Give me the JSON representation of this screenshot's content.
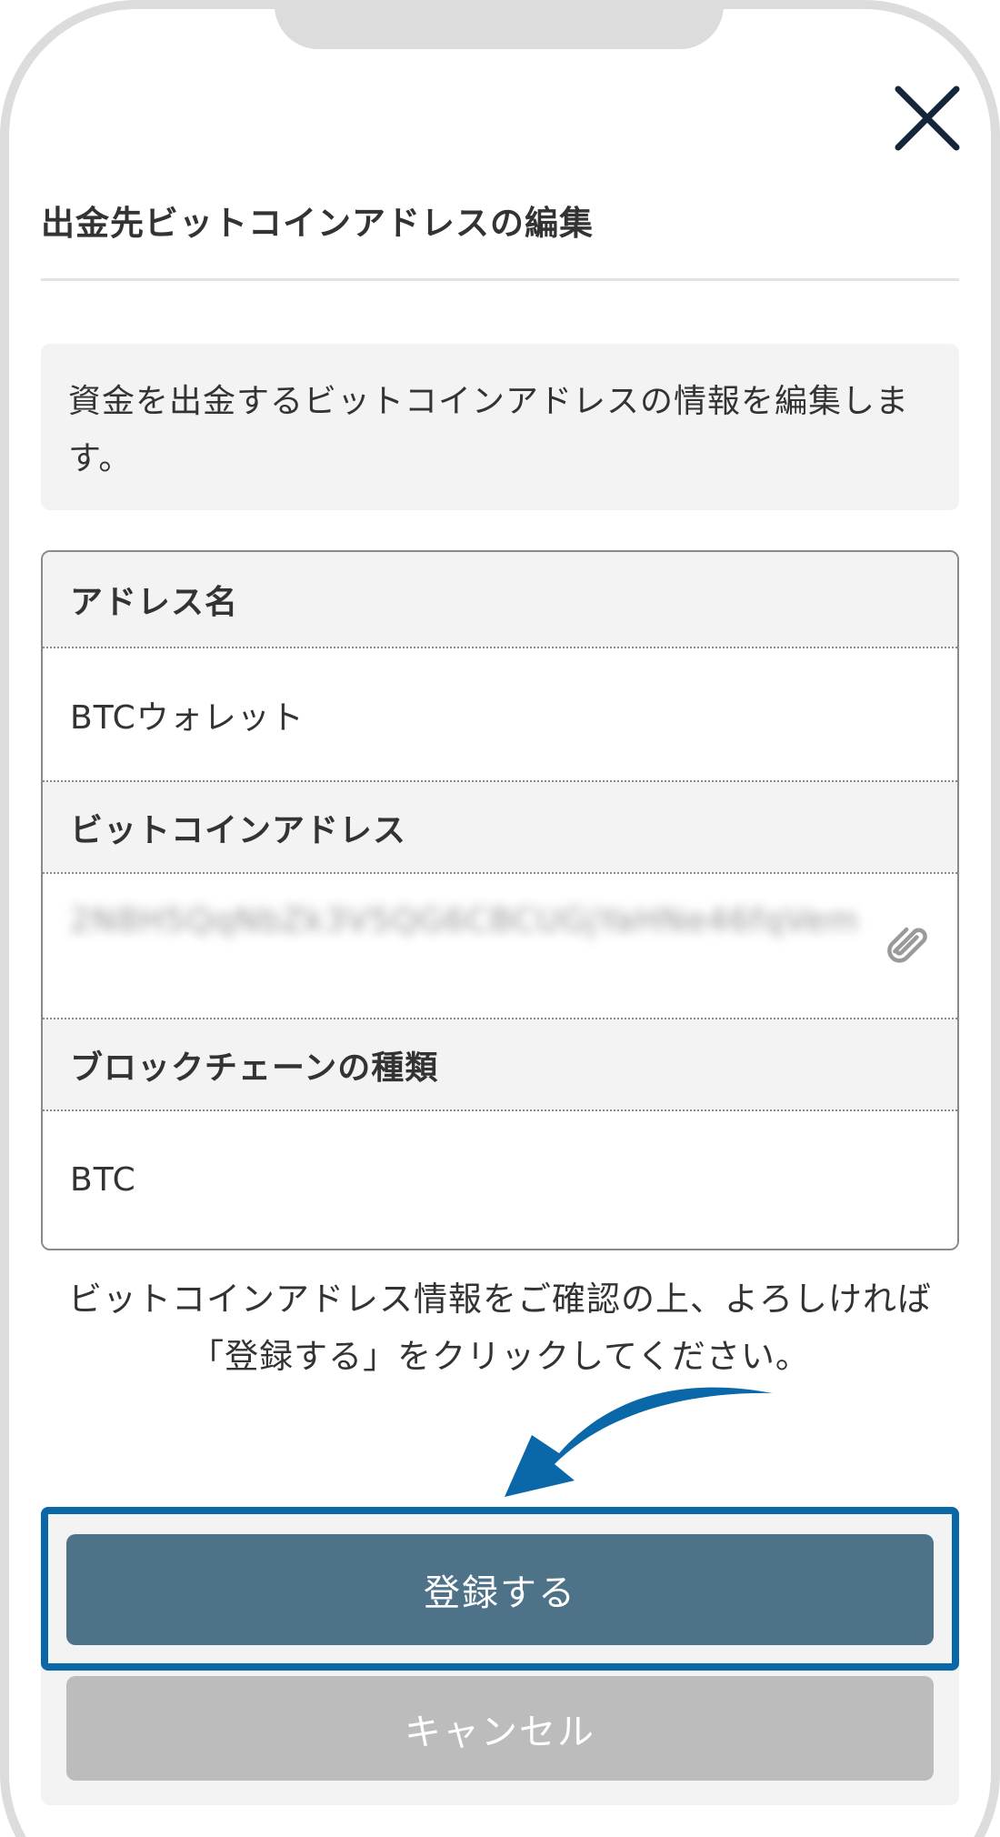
{
  "modal": {
    "title": "出金先ビットコインアドレスの編集",
    "description": "資金を出金するビットコインアドレスの情報を編集します。",
    "close_icon": "close-icon"
  },
  "fields": {
    "name_label": "アドレス名",
    "name_value": "BTCウォレット",
    "address_label": "ビットコインアドレス",
    "address_value": "2N8H5QqNbZk3V5QG6CBCUGjYaHNe46fqVem",
    "address_copy_icon": "paperclip-icon",
    "chain_label": "ブロックチェーンの種類",
    "chain_value": "BTC"
  },
  "confirm_message": "ビットコインアドレス情報をご確認の上、よろしければ「登録する」をクリックしてください。",
  "buttons": {
    "register_label": "登録する",
    "cancel_label": "キャンセル"
  },
  "colors": {
    "primary_button": "#4e7389",
    "cancel_button": "#bcbcbc",
    "highlight": "#0a67a8"
  }
}
